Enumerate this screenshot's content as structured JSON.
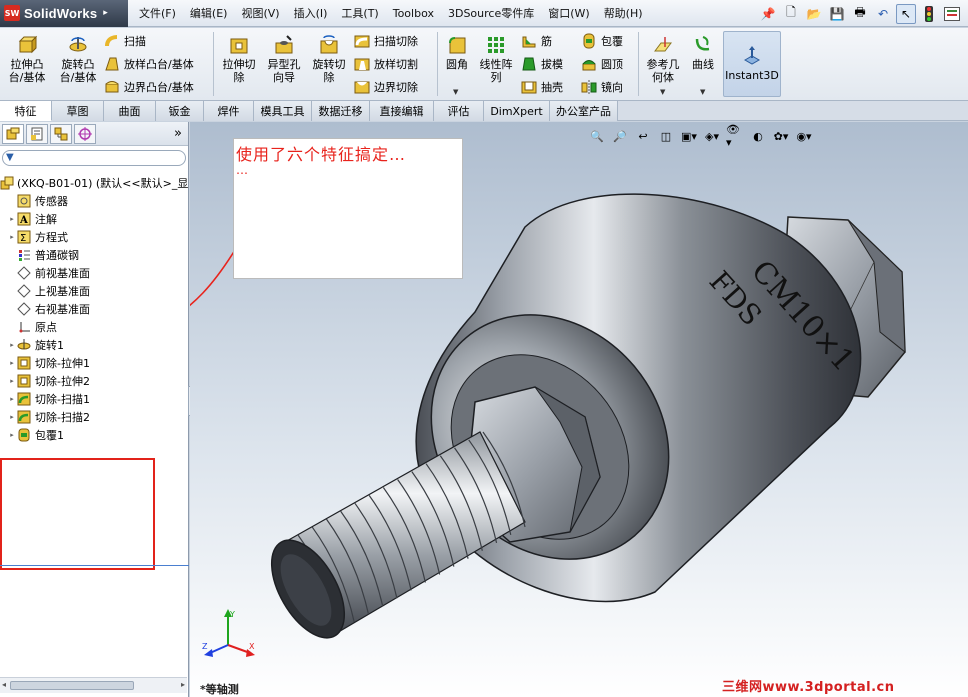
{
  "app": {
    "logo_badge": "SW",
    "name": "SolidWorks",
    "menu": [
      "文件(F)",
      "编辑(E)",
      "视图(V)",
      "插入(I)",
      "工具(T)",
      "Toolbox",
      "3DSource零件库",
      "窗口(W)",
      "帮助(H)"
    ]
  },
  "toolbar": {
    "features": {
      "extrude_boss": "拉伸凸\n台/基体",
      "revolve_boss": "旋转凸\n台/基体",
      "sweep": "扫描",
      "loft_boss": "放样凸台/基体",
      "boundary_boss": "边界凸台/基体",
      "extrude_cut": "拉伸切\n除",
      "hole_wizard": "异型孔\n向导",
      "revolve_cut": "旋转切\n除",
      "sweep_cut": "扫描切除",
      "loft_cut": "放样切割",
      "boundary_cut": "边界切除",
      "fillet": "圆角",
      "linear_pattern": "线性阵\n列",
      "rib": "筋",
      "draft": "拔模",
      "shell": "抽壳",
      "wrap": "包覆",
      "dome": "圆顶",
      "mirror": "镜向",
      "ref_geometry": "参考几\n何体",
      "curves": "曲线",
      "instant3d": "Instant3D"
    }
  },
  "tabs": [
    "特征",
    "草图",
    "曲面",
    "钣金",
    "焊件",
    "模具工具",
    "数据迁移",
    "直接编辑",
    "评估",
    "DimXpert",
    "办公室产品"
  ],
  "active_tab": "特征",
  "feature_tree": {
    "root": "(XKQ-B01-01) (默认<<默认>_显:",
    "items": [
      {
        "label": "传感器",
        "icon": "sensor-icon",
        "expandable": false
      },
      {
        "label": "注解",
        "icon": "annotation-icon",
        "expandable": true
      },
      {
        "label": "方程式",
        "icon": "equation-icon",
        "expandable": true
      },
      {
        "label": "普通碳钢",
        "icon": "material-icon",
        "expandable": false
      },
      {
        "label": "前视基准面",
        "icon": "plane-icon",
        "expandable": false
      },
      {
        "label": "上视基准面",
        "icon": "plane-icon",
        "expandable": false
      },
      {
        "label": "右视基准面",
        "icon": "plane-icon",
        "expandable": false
      },
      {
        "label": "原点",
        "icon": "origin-icon",
        "expandable": false
      },
      {
        "label": "旋转1",
        "icon": "revolve-icon",
        "expandable": true
      },
      {
        "label": "切除-拉伸1",
        "icon": "extrude-cut-icon",
        "expandable": true
      },
      {
        "label": "切除-拉伸2",
        "icon": "extrude-cut-icon",
        "expandable": true
      },
      {
        "label": "切除-扫描1",
        "icon": "sweep-cut-icon",
        "expandable": true
      },
      {
        "label": "切除-扫描2",
        "icon": "sweep-cut-icon",
        "expandable": true
      },
      {
        "label": "包覆1",
        "icon": "wrap-icon",
        "expandable": true
      }
    ]
  },
  "viewport": {
    "note_line1": "使用了六个特征搞定…",
    "note_line2": "…",
    "engraving_line1": "CM10×1",
    "engraving_line2": "FDS",
    "view_name": "*等轴测",
    "watermark": "三维网www.3dportal.cn",
    "triad_x": "X",
    "triad_y": "Y",
    "triad_z": "Z"
  },
  "colors": {
    "annotation_red": "#e8231c",
    "highlight_box": "#e2231a",
    "viewport_top": "#aebdcf",
    "panel_bg": "#ffffff"
  }
}
